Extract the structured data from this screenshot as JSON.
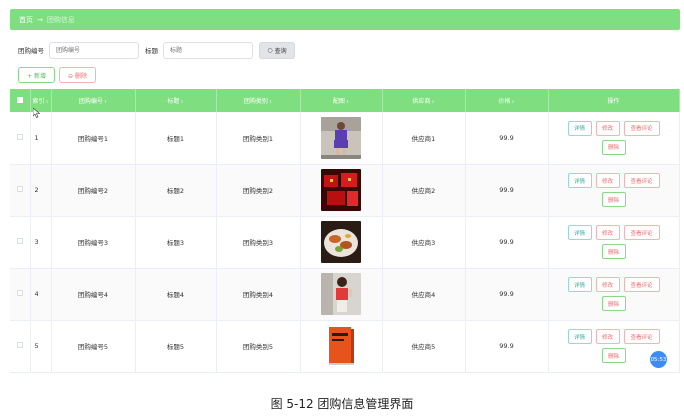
{
  "breadcrumb": {
    "home": "首页",
    "separator": "→",
    "current": "团购信息"
  },
  "search": {
    "field1_label": "团购编号",
    "field1_placeholder": "团购编号",
    "field2_label": "标题",
    "field2_placeholder": "标题",
    "query_label": "查询"
  },
  "actions": {
    "add_label": "+ 新增",
    "delete_label": "⊖ 删除"
  },
  "table": {
    "headers": [
      "",
      "索引",
      "团购编号",
      "标题",
      "团购类别",
      "配图",
      "供应商",
      "价格",
      "操作"
    ],
    "rows": [
      {
        "index": "1",
        "code": "团购编号1",
        "title": "标题1",
        "category": "团购类别1",
        "image": "woman-purple-outfit",
        "supplier": "供应商1",
        "price": "99.9"
      },
      {
        "index": "2",
        "code": "团购编号2",
        "title": "标题2",
        "category": "团购类别2",
        "image": "red-gift-boxes",
        "supplier": "供应商2",
        "price": "99.9"
      },
      {
        "index": "3",
        "code": "团购编号3",
        "title": "标题3",
        "category": "团购类别3",
        "image": "food-dish",
        "supplier": "供应商3",
        "price": "99.9"
      },
      {
        "index": "4",
        "code": "团购编号4",
        "title": "标题4",
        "category": "团购类别4",
        "image": "woman-red-top",
        "supplier": "供应商4",
        "price": "99.9"
      },
      {
        "index": "5",
        "code": "团购编号5",
        "title": "标题5",
        "category": "团购类别5",
        "image": "orange-book",
        "supplier": "供应商5",
        "price": "99.9"
      }
    ],
    "op_labels": {
      "detail": "详情",
      "edit": "修改",
      "review": "查看评论",
      "delete": "删除"
    }
  },
  "badge": {
    "text": "05:53"
  },
  "caption": "图 5-12  团购信息管理界面",
  "colors": {
    "accent": "#7ede80",
    "danger": "#ee6b6b",
    "badge": "#3b8df5"
  }
}
